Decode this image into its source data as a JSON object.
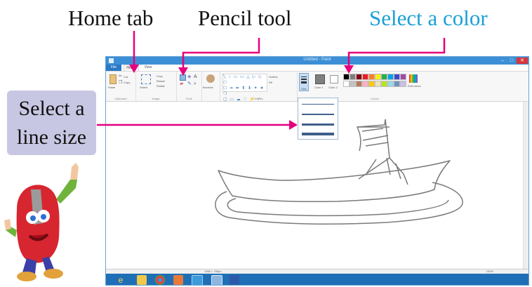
{
  "callouts": {
    "home_tab": "Home tab",
    "pencil_tool": "Pencil tool",
    "select_color": "Select a color",
    "select_line_size_line1": "Select a",
    "select_line_size_line2": "line size"
  },
  "window": {
    "title": "Untitled - Paint",
    "minimize": "–",
    "maximize": "□",
    "close": "✕"
  },
  "menu": {
    "file": "File",
    "home": "Home",
    "view": "View"
  },
  "ribbon": {
    "paste": "Paste",
    "cut": "Cut",
    "copy": "Copy",
    "clipboard": "Clipboard",
    "select": "Select",
    "crop": "Crop",
    "resize": "Resize",
    "rotate": "Rotate",
    "image": "Image",
    "tools": "Tools",
    "brushes": "Brushes",
    "shapes": "Shapes",
    "outline": "Outline",
    "fill": "Fill",
    "size": "Size",
    "color1": "Color 1",
    "color2": "Color 2",
    "colors": "Colors",
    "edit_colors": "Edit colors"
  },
  "colors": {
    "palette_row1": [
      "#000000",
      "#7f7f7f",
      "#880015",
      "#ed1c24",
      "#ff7f27",
      "#fff200",
      "#22b14c",
      "#00a2e8",
      "#3f48cc",
      "#a349a4"
    ],
    "palette_row2": [
      "#ffffff",
      "#c3c3c3",
      "#b97a57",
      "#ffaec9",
      "#ffc90e",
      "#efe4b0",
      "#b5e61d",
      "#99d9ea",
      "#7092be",
      "#c8bfe7"
    ],
    "callout_color_label": "#1aa0d6",
    "arrow": "#e6007e",
    "title_bar": "#3c8fd6"
  },
  "status": {
    "dimensions": "1366 × 768px",
    "zoom": "100%"
  },
  "icons": [
    "ie-icon",
    "explorer-icon",
    "chrome-icon",
    "media-icon",
    "paint-icon",
    "word-icon",
    "start-icon"
  ]
}
